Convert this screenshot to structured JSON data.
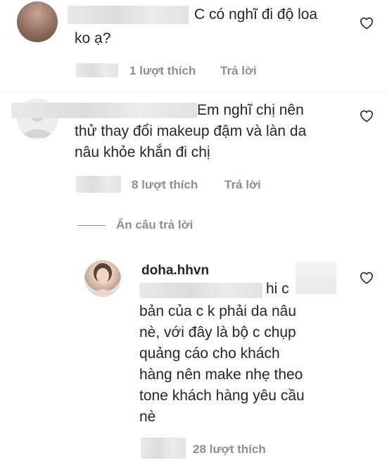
{
  "comments": [
    {
      "text_line1": "C có nghĩ đi độ loa",
      "text_line2": "ko ạ?",
      "likes": "1 lượt thích",
      "reply": "Trả lời",
      "heart_icon": "heart-outline-icon"
    },
    {
      "text_line1": "Em nghĩ chị nên",
      "text_line2": "thử thay đổi makeup đậm và làn da",
      "text_line3": "nâu khỏe khắn đi chị",
      "likes": "8 lượt thích",
      "reply": "Trả lời",
      "heart_icon": "heart-outline-icon"
    }
  ],
  "hide_replies": "Ẩn câu trả lời",
  "reply_comment": {
    "username": "doha.hhvn",
    "mention_tail": "hi c",
    "lines": [
      "bản của c k phải da nâu",
      "nè, với đây là bộ c chụp",
      "quảng cáo cho khách",
      "hàng nên make nhẹ theo",
      "tone khách hàng yêu cầu",
      "nè"
    ],
    "likes": "28 lượt thích",
    "heart_icon": "heart-outline-icon"
  }
}
